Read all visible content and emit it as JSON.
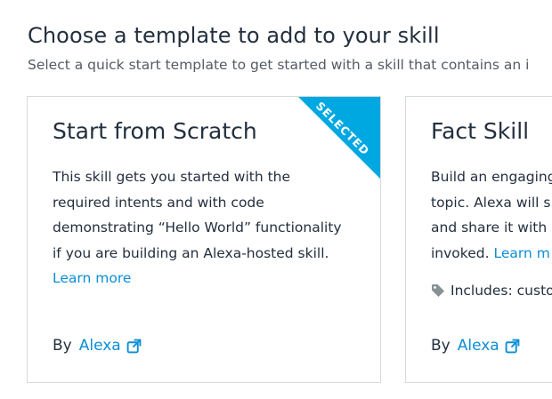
{
  "header": {
    "title": "Choose a template to add to your skill",
    "subtitle": "Select a quick start template to get started with a skill that contains an i"
  },
  "cards": [
    {
      "title": "Start from Scratch",
      "badge": "SELECTED",
      "description_lines": [
        "This skill gets you started with the",
        "required intents and with code",
        "demonstrating “Hello World” functionality",
        "if you are building an Alexa-hosted skill."
      ],
      "learn_more": "Learn more",
      "by_label": "By",
      "author": "Alexa",
      "author_icon": "external-link-icon"
    },
    {
      "title": "Fact Skill",
      "description_lines": [
        "Build an engaging",
        "topic. Alexa will s",
        "and share it with",
        "invoked."
      ],
      "learn_more": "Learn m",
      "includes": "Includes: custo",
      "includes_icon": "tag-icon",
      "by_label": "By",
      "author": "Alexa",
      "author_icon": "external-link-icon"
    }
  ],
  "colors": {
    "accent": "#00a8e1",
    "link": "#0b8ed6",
    "text": "#232f3e",
    "muted": "#545b64",
    "border": "#d5dbdb"
  }
}
